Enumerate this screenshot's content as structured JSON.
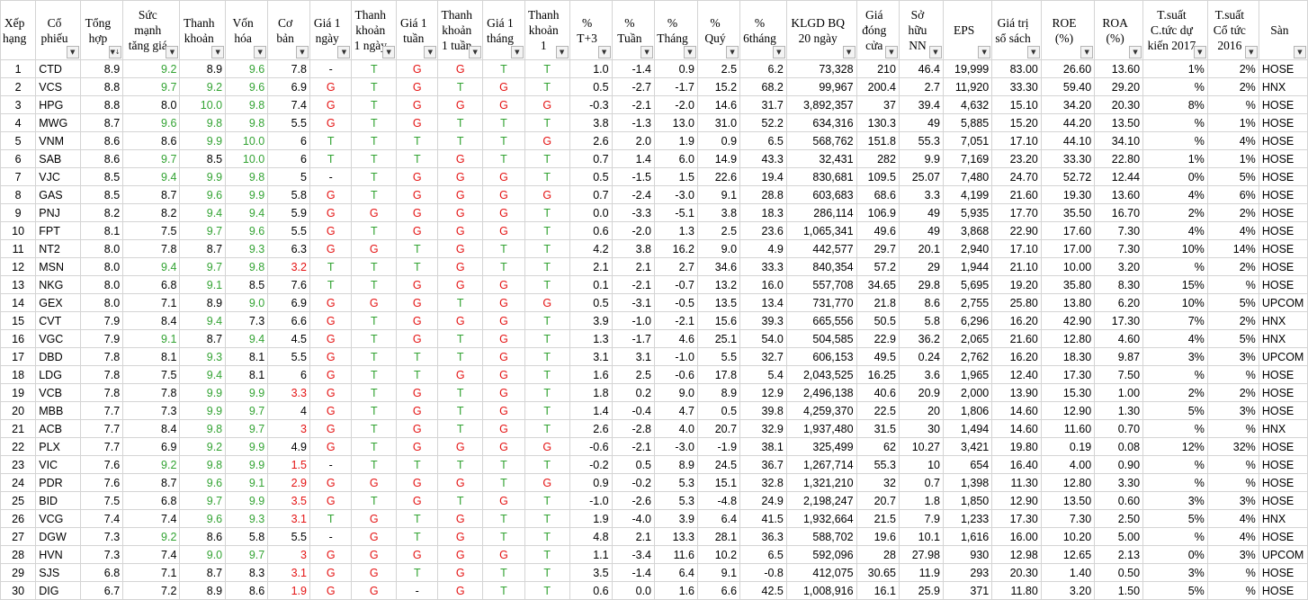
{
  "colors": {
    "green": "#33a333",
    "red": "#e41414",
    "black": "#000000"
  },
  "columns": [
    {
      "label": "Xếp hạng",
      "w": 38,
      "align": "rank",
      "filter": false
    },
    {
      "label": "Cổ phiếu",
      "w": 50,
      "align": "lft"
    },
    {
      "label": "Tổng hợp",
      "w": 48,
      "align": "num",
      "sort": "desc"
    },
    {
      "label": "Sức mạnh tăng giá",
      "w": 65,
      "align": "num"
    },
    {
      "label": "Thanh khoản",
      "w": 51,
      "align": "num"
    },
    {
      "label": "Vốn hóa",
      "w": 48,
      "align": "num"
    },
    {
      "label": "Cơ bản",
      "w": 48,
      "align": "num"
    },
    {
      "label": "Giá 1 ngày",
      "w": 47,
      "align": "ctr"
    },
    {
      "label": "Thanh khoản 1 ngày",
      "w": 50,
      "align": "ctr"
    },
    {
      "label": "Giá 1 tuần",
      "w": 47,
      "align": "ctr"
    },
    {
      "label": "Thanh khoản 1 tuần",
      "w": 50,
      "align": "ctr"
    },
    {
      "label": "Giá 1 tháng",
      "w": 47,
      "align": "ctr"
    },
    {
      "label": "Thanh khoản 1 tháng",
      "w": 50,
      "align": "ctr"
    },
    {
      "label": "% T+3",
      "w": 48,
      "align": "num"
    },
    {
      "label": "% Tuần",
      "w": 48,
      "align": "num"
    },
    {
      "label": "% Tháng",
      "w": 48,
      "align": "num"
    },
    {
      "label": "% Quý",
      "w": 48,
      "align": "num"
    },
    {
      "label": "% 6tháng",
      "w": 52,
      "align": "num"
    },
    {
      "label": "KLGD BQ 20 ngày",
      "w": 79,
      "align": "num"
    },
    {
      "label": "Giá đóng cửa",
      "w": 48,
      "align": "num"
    },
    {
      "label": "Sở hữu NN",
      "w": 50,
      "align": "num"
    },
    {
      "label": "EPS",
      "w": 55,
      "align": "num"
    },
    {
      "label": "Giá trị sổ sách",
      "w": 56,
      "align": "num"
    },
    {
      "label": "ROE (%)",
      "w": 61,
      "align": "num"
    },
    {
      "label": "ROA (%)",
      "w": 55,
      "align": "num"
    },
    {
      "label": "T.suất C.tức dự kiến 2017",
      "w": 74,
      "align": "num"
    },
    {
      "label": "T.suất Cổ tức 2016",
      "w": 58,
      "align": "num"
    },
    {
      "label": "Sàn",
      "w": 54,
      "align": "lft"
    }
  ],
  "rows": [
    [
      "1",
      "CTD",
      "8.9",
      "9.2",
      "8.9",
      "9.6",
      "7.8",
      "-",
      "T",
      "G",
      "G",
      "T",
      "T",
      "1.0",
      "-1.4",
      "0.9",
      "2.5",
      "6.2",
      "73,328",
      "210",
      "46.4",
      "19,999",
      "83.00",
      "26.60",
      "13.60",
      "1%",
      "2%",
      "HOSE"
    ],
    [
      "2",
      "VCS",
      "8.8",
      "9.7",
      "9.2",
      "9.6",
      "6.9",
      "G",
      "T",
      "G",
      "T",
      "G",
      "T",
      "0.5",
      "-2.7",
      "-1.7",
      "15.2",
      "68.2",
      "99,967",
      "200.4",
      "2.7",
      "11,920",
      "33.30",
      "59.40",
      "29.20",
      "%",
      "2%",
      "HNX"
    ],
    [
      "3",
      "HPG",
      "8.8",
      "8.0",
      "10.0",
      "9.8",
      "7.4",
      "G",
      "T",
      "G",
      "G",
      "G",
      "G",
      "-0.3",
      "-2.1",
      "-2.0",
      "14.6",
      "31.7",
      "3,892,357",
      "37",
      "39.4",
      "4,632",
      "15.10",
      "34.20",
      "20.30",
      "8%",
      "%",
      "HOSE"
    ],
    [
      "4",
      "MWG",
      "8.7",
      "9.6",
      "9.8",
      "9.8",
      "5.5",
      "G",
      "T",
      "G",
      "T",
      "T",
      "T",
      "3.8",
      "-1.3",
      "13.0",
      "31.0",
      "52.2",
      "634,316",
      "130.3",
      "49",
      "5,885",
      "15.20",
      "44.20",
      "13.50",
      "%",
      "1%",
      "HOSE"
    ],
    [
      "5",
      "VNM",
      "8.6",
      "8.6",
      "9.9",
      "10.0",
      "6",
      "T",
      "T",
      "T",
      "T",
      "T",
      "G",
      "2.6",
      "2.0",
      "1.9",
      "0.9",
      "6.5",
      "568,762",
      "151.8",
      "55.3",
      "7,051",
      "17.10",
      "44.10",
      "34.10",
      "%",
      "4%",
      "HOSE"
    ],
    [
      "6",
      "SAB",
      "8.6",
      "9.7",
      "8.5",
      "10.0",
      "6",
      "T",
      "T",
      "T",
      "G",
      "T",
      "T",
      "0.7",
      "1.4",
      "6.0",
      "14.9",
      "43.3",
      "32,431",
      "282",
      "9.9",
      "7,169",
      "23.20",
      "33.30",
      "22.80",
      "1%",
      "1%",
      "HOSE"
    ],
    [
      "7",
      "VJC",
      "8.5",
      "9.4",
      "9.9",
      "9.8",
      "5",
      "-",
      "T",
      "G",
      "G",
      "G",
      "T",
      "0.5",
      "-1.5",
      "1.5",
      "22.6",
      "19.4",
      "830,681",
      "109.5",
      "25.07",
      "7,480",
      "24.70",
      "52.72",
      "12.44",
      "0%",
      "5%",
      "HOSE"
    ],
    [
      "8",
      "GAS",
      "8.5",
      "8.7",
      "9.6",
      "9.9",
      "5.8",
      "G",
      "T",
      "G",
      "G",
      "G",
      "G",
      "0.7",
      "-2.4",
      "-3.0",
      "9.1",
      "28.8",
      "603,683",
      "68.6",
      "3.3",
      "4,199",
      "21.60",
      "19.30",
      "13.60",
      "4%",
      "6%",
      "HOSE"
    ],
    [
      "9",
      "PNJ",
      "8.2",
      "8.2",
      "9.4",
      "9.4",
      "5.9",
      "G",
      "G",
      "G",
      "G",
      "G",
      "T",
      "0.0",
      "-3.3",
      "-5.1",
      "3.8",
      "18.3",
      "286,114",
      "106.9",
      "49",
      "5,935",
      "17.70",
      "35.50",
      "16.70",
      "2%",
      "2%",
      "HOSE"
    ],
    [
      "10",
      "FPT",
      "8.1",
      "7.5",
      "9.7",
      "9.6",
      "5.5",
      "G",
      "T",
      "G",
      "G",
      "G",
      "T",
      "0.6",
      "-2.0",
      "1.3",
      "2.5",
      "23.6",
      "1,065,341",
      "49.6",
      "49",
      "3,868",
      "22.90",
      "17.60",
      "7.30",
      "4%",
      "4%",
      "HOSE"
    ],
    [
      "11",
      "NT2",
      "8.0",
      "7.8",
      "8.7",
      "9.3",
      "6.3",
      "G",
      "G",
      "T",
      "G",
      "T",
      "T",
      "4.2",
      "3.8",
      "16.2",
      "9.0",
      "4.9",
      "442,577",
      "29.7",
      "20.1",
      "2,940",
      "17.10",
      "17.00",
      "7.30",
      "10%",
      "14%",
      "HOSE"
    ],
    [
      "12",
      "MSN",
      "8.0",
      "9.4",
      "9.7",
      "9.8",
      "3.2",
      "T",
      "T",
      "T",
      "G",
      "T",
      "T",
      "2.1",
      "2.1",
      "2.7",
      "34.6",
      "33.3",
      "840,354",
      "57.2",
      "29",
      "1,944",
      "21.10",
      "10.00",
      "3.20",
      "%",
      "2%",
      "HOSE"
    ],
    [
      "13",
      "NKG",
      "8.0",
      "6.8",
      "9.1",
      "8.5",
      "7.6",
      "T",
      "T",
      "G",
      "G",
      "G",
      "T",
      "0.1",
      "-2.1",
      "-0.7",
      "13.2",
      "16.0",
      "557,708",
      "34.65",
      "29.8",
      "5,695",
      "19.20",
      "35.80",
      "8.30",
      "15%",
      "%",
      "HOSE"
    ],
    [
      "14",
      "GEX",
      "8.0",
      "7.1",
      "8.9",
      "9.0",
      "6.9",
      "G",
      "G",
      "G",
      "T",
      "G",
      "G",
      "0.5",
      "-3.1",
      "-0.5",
      "13.5",
      "13.4",
      "731,770",
      "21.8",
      "8.6",
      "2,755",
      "25.80",
      "13.80",
      "6.20",
      "10%",
      "5%",
      "UPCOM"
    ],
    [
      "15",
      "CVT",
      "7.9",
      "8.4",
      "9.4",
      "7.3",
      "6.6",
      "G",
      "T",
      "G",
      "G",
      "G",
      "T",
      "3.9",
      "-1.0",
      "-2.1",
      "15.6",
      "39.3",
      "665,556",
      "50.5",
      "5.8",
      "6,296",
      "16.20",
      "42.90",
      "17.30",
      "7%",
      "2%",
      "HNX"
    ],
    [
      "16",
      "VGC",
      "7.9",
      "9.1",
      "8.7",
      "9.4",
      "4.5",
      "G",
      "T",
      "G",
      "T",
      "G",
      "T",
      "1.3",
      "-1.7",
      "4.6",
      "25.1",
      "54.0",
      "504,585",
      "22.9",
      "36.2",
      "2,065",
      "21.60",
      "12.80",
      "4.60",
      "4%",
      "5%",
      "HNX"
    ],
    [
      "17",
      "DBD",
      "7.8",
      "8.1",
      "9.3",
      "8.1",
      "5.5",
      "G",
      "T",
      "T",
      "T",
      "G",
      "T",
      "3.1",
      "3.1",
      "-1.0",
      "5.5",
      "32.7",
      "606,153",
      "49.5",
      "0.24",
      "2,762",
      "16.20",
      "18.30",
      "9.87",
      "3%",
      "3%",
      "UPCOM"
    ],
    [
      "18",
      "LDG",
      "7.8",
      "7.5",
      "9.4",
      "8.1",
      "6",
      "G",
      "T",
      "T",
      "G",
      "G",
      "T",
      "1.6",
      "2.5",
      "-0.6",
      "17.8",
      "5.4",
      "2,043,525",
      "16.25",
      "3.6",
      "1,965",
      "12.40",
      "17.30",
      "7.50",
      "%",
      "%",
      "HOSE"
    ],
    [
      "19",
      "VCB",
      "7.8",
      "7.8",
      "9.9",
      "9.9",
      "3.3",
      "G",
      "T",
      "G",
      "T",
      "G",
      "T",
      "1.8",
      "0.2",
      "9.0",
      "8.9",
      "12.9",
      "2,496,138",
      "40.6",
      "20.9",
      "2,000",
      "13.90",
      "15.30",
      "1.00",
      "2%",
      "2%",
      "HOSE"
    ],
    [
      "20",
      "MBB",
      "7.7",
      "7.3",
      "9.9",
      "9.7",
      "4",
      "G",
      "T",
      "G",
      "T",
      "G",
      "T",
      "1.4",
      "-0.4",
      "4.7",
      "0.5",
      "39.8",
      "4,259,370",
      "22.5",
      "20",
      "1,806",
      "14.60",
      "12.90",
      "1.30",
      "5%",
      "3%",
      "HOSE"
    ],
    [
      "21",
      "ACB",
      "7.7",
      "8.4",
      "9.8",
      "9.7",
      "3",
      "G",
      "T",
      "G",
      "T",
      "G",
      "T",
      "2.6",
      "-2.8",
      "4.0",
      "20.7",
      "32.9",
      "1,937,480",
      "31.5",
      "30",
      "1,494",
      "14.60",
      "11.60",
      "0.70",
      "%",
      "%",
      "HNX"
    ],
    [
      "22",
      "PLX",
      "7.7",
      "6.9",
      "9.2",
      "9.9",
      "4.9",
      "G",
      "T",
      "G",
      "G",
      "G",
      "G",
      "-0.6",
      "-2.1",
      "-3.0",
      "-1.9",
      "38.1",
      "325,499",
      "62",
      "10.27",
      "3,421",
      "19.80",
      "0.19",
      "0.08",
      "12%",
      "32%",
      "HOSE"
    ],
    [
      "23",
      "VIC",
      "7.6",
      "9.2",
      "9.8",
      "9.9",
      "1.5",
      "-",
      "T",
      "T",
      "T",
      "T",
      "T",
      "-0.2",
      "0.5",
      "8.9",
      "24.5",
      "36.7",
      "1,267,714",
      "55.3",
      "10",
      "654",
      "16.40",
      "4.00",
      "0.90",
      "%",
      "%",
      "HOSE"
    ],
    [
      "24",
      "PDR",
      "7.6",
      "8.7",
      "9.6",
      "9.1",
      "2.9",
      "G",
      "G",
      "G",
      "G",
      "T",
      "G",
      "0.9",
      "-0.2",
      "5.3",
      "15.1",
      "32.8",
      "1,321,210",
      "32",
      "0.7",
      "1,398",
      "11.30",
      "12.80",
      "3.30",
      "%",
      "%",
      "HOSE"
    ],
    [
      "25",
      "BID",
      "7.5",
      "6.8",
      "9.7",
      "9.9",
      "3.5",
      "G",
      "T",
      "G",
      "T",
      "G",
      "T",
      "-1.0",
      "-2.6",
      "5.3",
      "-4.8",
      "24.9",
      "2,198,247",
      "20.7",
      "1.8",
      "1,850",
      "12.90",
      "13.50",
      "0.60",
      "3%",
      "3%",
      "HOSE"
    ],
    [
      "26",
      "VCG",
      "7.4",
      "7.4",
      "9.6",
      "9.3",
      "3.1",
      "T",
      "G",
      "T",
      "G",
      "T",
      "T",
      "1.9",
      "-4.0",
      "3.9",
      "6.4",
      "41.5",
      "1,932,664",
      "21.5",
      "7.9",
      "1,233",
      "17.30",
      "7.30",
      "2.50",
      "5%",
      "4%",
      "HNX"
    ],
    [
      "27",
      "DGW",
      "7.3",
      "9.2",
      "8.6",
      "5.8",
      "5.5",
      "-",
      "G",
      "T",
      "G",
      "T",
      "T",
      "4.8",
      "2.1",
      "13.3",
      "28.1",
      "36.3",
      "588,702",
      "19.6",
      "10.1",
      "1,616",
      "16.00",
      "10.20",
      "5.00",
      "%",
      "4%",
      "HOSE"
    ],
    [
      "28",
      "HVN",
      "7.3",
      "7.4",
      "9.0",
      "9.7",
      "3",
      "G",
      "G",
      "G",
      "G",
      "G",
      "T",
      "1.1",
      "-3.4",
      "11.6",
      "10.2",
      "6.5",
      "592,096",
      "28",
      "27.98",
      "930",
      "12.98",
      "12.65",
      "2.13",
      "0%",
      "3%",
      "UPCOM"
    ],
    [
      "29",
      "SJS",
      "6.8",
      "7.1",
      "8.7",
      "8.3",
      "3.1",
      "G",
      "G",
      "T",
      "G",
      "T",
      "T",
      "3.5",
      "-1.4",
      "6.4",
      "9.1",
      "-0.8",
      "412,075",
      "30.65",
      "11.9",
      "293",
      "20.30",
      "1.40",
      "0.50",
      "3%",
      "%",
      "HOSE"
    ],
    [
      "30",
      "DIG",
      "6.7",
      "7.2",
      "8.9",
      "8.6",
      "1.9",
      "G",
      "G",
      "-",
      "G",
      "T",
      "T",
      "0.6",
      "0.0",
      "1.6",
      "6.6",
      "42.5",
      "1,008,916",
      "16.1",
      "25.9",
      "371",
      "11.80",
      "3.20",
      "1.50",
      "5%",
      "%",
      "HOSE"
    ]
  ]
}
